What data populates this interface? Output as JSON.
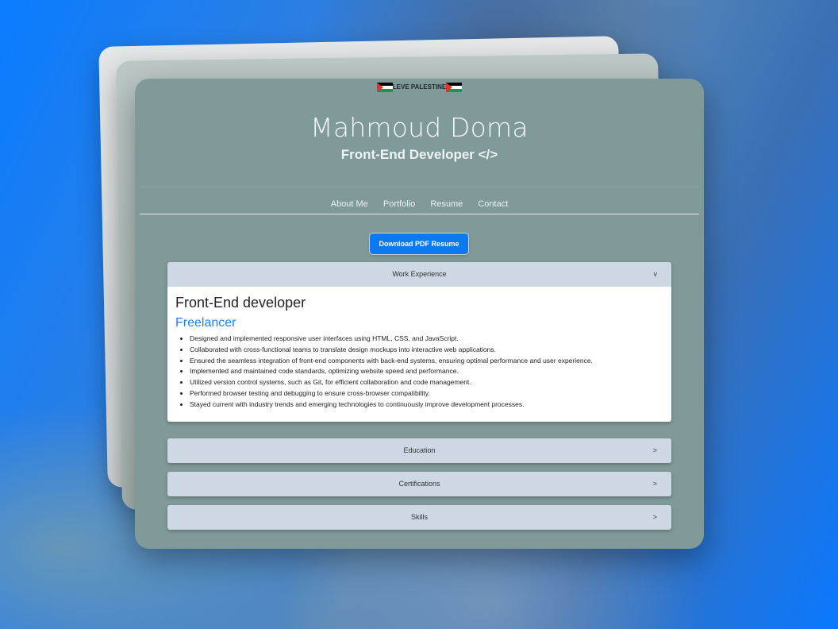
{
  "banner": {
    "text": "LEVE PALESTINE",
    "flag_icon": "palestine-flag-icon"
  },
  "header": {
    "name": "Mahmoud Doma",
    "role": "Front-End Developer </>"
  },
  "nav": {
    "items": [
      "About Me",
      "Portfolio",
      "Resume",
      "Contact"
    ]
  },
  "resume": {
    "download_label": "Download PDF Resume"
  },
  "sections": [
    {
      "label": "Work Experience",
      "chevron": "v",
      "expanded": true
    },
    {
      "label": "Education",
      "chevron": ">",
      "expanded": false
    },
    {
      "label": "Certifications",
      "chevron": ">",
      "expanded": false
    },
    {
      "label": "Skills",
      "chevron": ">",
      "expanded": false
    }
  ],
  "work": {
    "title": "Front-End developer",
    "company": "Freelancer",
    "bullets": [
      "Designed and implemented responsive user interfaces using HTML, CSS, and JavaScript.",
      "Collaborated with cross-functional teams to translate design mockups into interactive web applications.",
      "Ensured the seamless integration of front-end components with back-end systems, ensuring optimal performance and user experience.",
      "Implemented and maintained code standards, optimizing website speed and performance.",
      "Utilized version control systems, such as Git, for efficient collaboration and code management.",
      "Performed browser testing and debugging to ensure cross-browser compatibility.",
      "Stayed current with industry trends and emerging technologies to continuously improve development processes."
    ]
  },
  "colors": {
    "accent": "#0b79f0",
    "page_bg": "#7f9a98",
    "accordion_header": "#ced8e4",
    "company": "#1f7ef0"
  }
}
